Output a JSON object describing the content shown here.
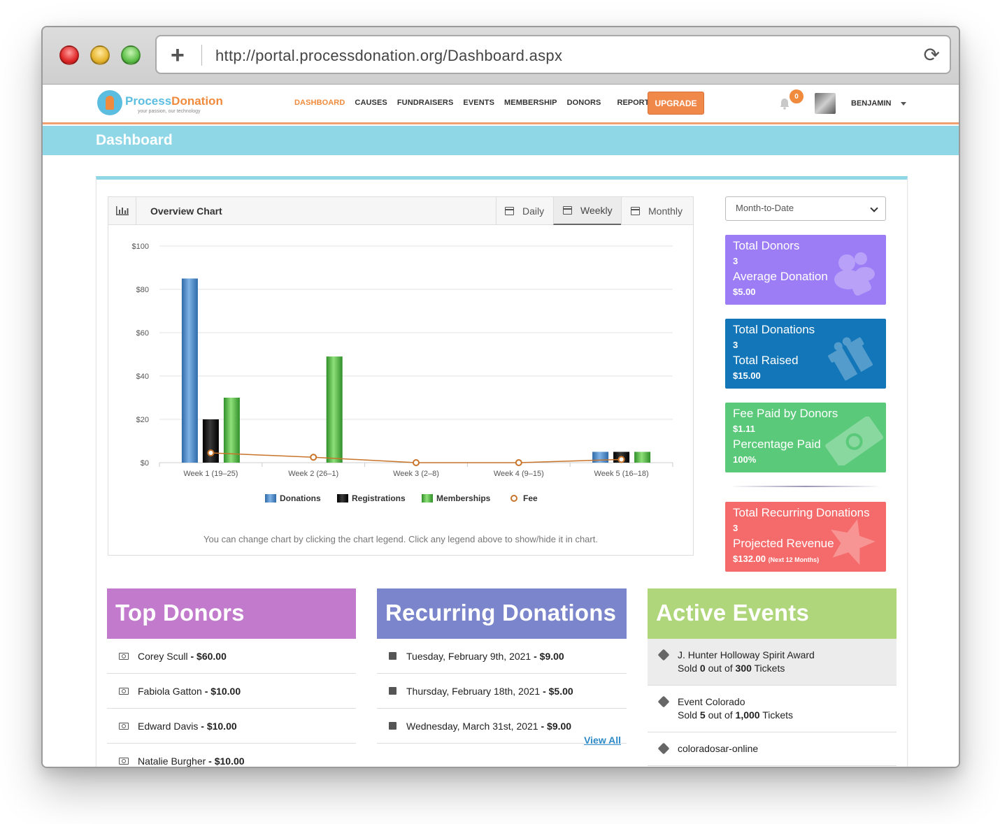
{
  "browser": {
    "url": "http://portal.processdonation.org/Dashboard.aspx",
    "plus": "+",
    "reload": "⟳"
  },
  "logo": {
    "part1": "Process",
    "part2": "Donation",
    "tagline": "your passion, our technology"
  },
  "nav": {
    "items": [
      {
        "label": "DASHBOARD",
        "active": true
      },
      {
        "label": "CAUSES"
      },
      {
        "label": "FUNDRAISERS"
      },
      {
        "label": "EVENTS"
      },
      {
        "label": "MEMBERSHIP"
      },
      {
        "label": "DONORS"
      },
      {
        "label": "REPORTS"
      }
    ],
    "upgrade": "UPGRADE",
    "notifications": "0",
    "user": "BENJAMIN"
  },
  "page": {
    "title": "Dashboard"
  },
  "overview": {
    "title": "Overview Chart",
    "tabs": [
      "Daily",
      "Weekly",
      "Monthly"
    ],
    "active_tab": "Weekly",
    "note": "You can change chart by clicking the chart legend. Click any legend above to show/hide it in chart."
  },
  "chart_data": {
    "type": "bar",
    "categories": [
      "Week 1 (19–25)",
      "Week 2 (26–1)",
      "Week 3 (2–8)",
      "Week 4 (9–15)",
      "Week 5 (16–18)"
    ],
    "series": [
      {
        "name": "Donations",
        "type": "bar",
        "color": "#3f80c6",
        "values": [
          85,
          0,
          0,
          0,
          5
        ]
      },
      {
        "name": "Registrations",
        "type": "bar",
        "color": "#1a1a1a",
        "values": [
          20,
          0,
          0,
          0,
          5
        ]
      },
      {
        "name": "Memberships",
        "type": "bar",
        "color": "#4caf3f",
        "values": [
          30,
          49,
          0,
          0,
          5
        ]
      },
      {
        "name": "Fee",
        "type": "line",
        "color": "#c8742a",
        "values": [
          4.5,
          2.5,
          0,
          0,
          1.5
        ]
      }
    ],
    "yticks": [
      "$100",
      "$80",
      "$60",
      "$40",
      "$20",
      "$0"
    ],
    "ylim": [
      0,
      100
    ],
    "grid": true,
    "legend": "bottom"
  },
  "range_select": "Month-to-Date",
  "stats": [
    {
      "label1": "Total Donors",
      "value1": "3",
      "label2": "Average Donation",
      "value2": "$5.00",
      "icon": "users-icon"
    },
    {
      "label1": "Total Donations",
      "value1": "3",
      "label2": "Total Raised",
      "value2": "$15.00",
      "icon": "gift-icon"
    },
    {
      "label1": "Fee Paid by Donors",
      "value1": "$1.11",
      "label2": "Percentage Paid",
      "value2": "100%",
      "icon": "money-icon"
    },
    {
      "label1": "Total Recurring Donations",
      "value1": "3",
      "label2": "Projected Revenue",
      "value2": "$132.00",
      "value2_note": "(Next 12 Months)",
      "icon": "star-icon"
    }
  ],
  "top_donors": {
    "title": "Top Donors",
    "rows": [
      {
        "name": "Corey Scull",
        "amount": "$60.00"
      },
      {
        "name": "Fabiola Gatton",
        "amount": "$10.00"
      },
      {
        "name": "Edward Davis",
        "amount": "$10.00"
      },
      {
        "name": "Natalie Burgher",
        "amount": "$10.00"
      }
    ]
  },
  "recurring": {
    "title": "Recurring Donations",
    "rows": [
      {
        "date": "Tuesday, February 9th, 2021",
        "amount": "$9.00"
      },
      {
        "date": "Thursday, February 18th, 2021",
        "amount": "$5.00"
      },
      {
        "date": "Wednesday, March 31st, 2021",
        "amount": "$9.00"
      }
    ],
    "view_all": "View All"
  },
  "events": {
    "title": "Active Events",
    "rows": [
      {
        "name": "J. Hunter Holloway Spirit Award",
        "sold": "0",
        "total": "300"
      },
      {
        "name": "Event Colorado",
        "sold": "5",
        "total": "1,000"
      },
      {
        "name": "coloradosar-online",
        "sold": "",
        "total": ""
      }
    ],
    "sold_prefix": "Sold",
    "out_of": "out of",
    "tickets": "Tickets"
  }
}
